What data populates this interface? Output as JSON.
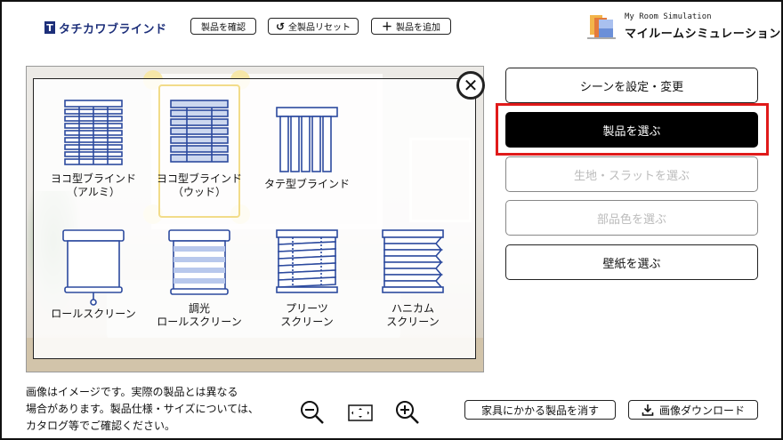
{
  "header": {
    "logo_mark": "T",
    "logo_text": "タチカワブラインド",
    "check_products_label": "製品を確認",
    "reset_all_label": "全製品リセット",
    "reset_icon": "undo-icon",
    "add_product_label": "製品を追加",
    "add_icon": "plus-icon",
    "brand_small": "My Room Simulation",
    "brand_big": "マイルームシミュレーション"
  },
  "products": [
    {
      "label": "ヨコ型ブラインド\n（アルミ）",
      "icon": "venetian-aluminum-blind-icon"
    },
    {
      "label": "ヨコ型ブラインド\n（ウッド）",
      "icon": "venetian-wood-blind-icon"
    },
    {
      "label": "タテ型ブラインド",
      "icon": "vertical-blind-icon"
    },
    {
      "label": "ロールスクリーン",
      "icon": "roller-screen-icon"
    },
    {
      "label": "調光\nロールスクリーン",
      "icon": "dimming-roller-screen-icon"
    },
    {
      "label": "プリーツ\nスクリーン",
      "icon": "pleated-screen-icon"
    },
    {
      "label": "ハニカム\nスクリーン",
      "icon": "honeycomb-screen-icon"
    }
  ],
  "menu": [
    {
      "label": "シーンを設定・変更",
      "state": "normal"
    },
    {
      "label": "製品を選ぶ",
      "state": "active"
    },
    {
      "label": "生地・スラットを選ぶ",
      "state": "disabled"
    },
    {
      "label": "部品色を選ぶ",
      "state": "disabled"
    },
    {
      "label": "壁紙を選ぶ",
      "state": "normal"
    }
  ],
  "footer": {
    "note_lines": [
      "画像はイメージです。実際の製品とは異なる",
      "場合があります。製品仕様・サイズについては、",
      "カタログ等でご確認ください。"
    ],
    "hide_furniture_label": "家具にかかる製品を消す",
    "download_label": "画像ダウンロード",
    "download_icon": "download-icon"
  },
  "colors": {
    "brand": "#1d2f7a",
    "icon_blue": "#2c4a9e",
    "active": "#000000",
    "highlight": "#e01a1a"
  }
}
